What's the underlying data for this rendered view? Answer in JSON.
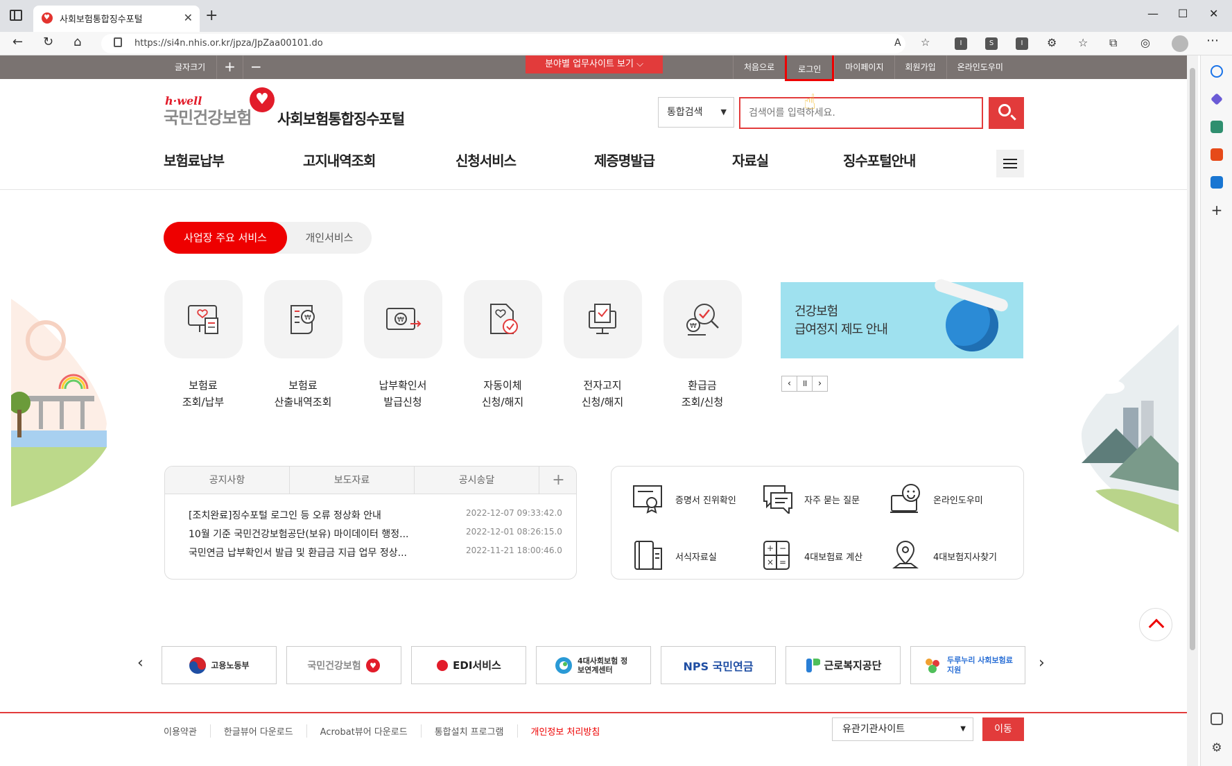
{
  "browser": {
    "tab_title": "사회보험통합징수포털",
    "url": "https://si4n.nhis.or.kr/jpza/JpZaa00101.do"
  },
  "util_bar": {
    "font_size_label": "글자크기",
    "font_plus": "+",
    "font_minus": "−",
    "field_site_button": "분야별 업무사이트 보기",
    "links": [
      "처음으로",
      "로그인",
      "마이페이지",
      "회원가입",
      "온라인도우미"
    ]
  },
  "header": {
    "logo_small": "h·well",
    "logo_name": "국민건강보험",
    "site_title": "사회보험통합징수포털",
    "search_scope": "통합검색",
    "search_placeholder": "검색어를 입력하세요."
  },
  "gnb": [
    "보험료납부",
    "고지내역조회",
    "신청서비스",
    "제증명발급",
    "자료실",
    "징수포털안내"
  ],
  "service_tabs": {
    "active": "사업장 주요 서비스",
    "inactive": "개인서비스"
  },
  "services": [
    {
      "line1": "보험료",
      "line2": "조회/납부",
      "icon": "receipt-icon"
    },
    {
      "line1": "보험료",
      "line2": "산출내역조회",
      "icon": "calculation-doc-icon"
    },
    {
      "line1": "납부확인서",
      "line2": "발급신청",
      "icon": "payment-certificate-icon"
    },
    {
      "line1": "자동이체",
      "line2": "신청/해지",
      "icon": "auto-transfer-icon"
    },
    {
      "line1": "전자고지",
      "line2": "신청/해지",
      "icon": "e-notice-icon"
    },
    {
      "line1": "환급금",
      "line2": "조회/신청",
      "icon": "refund-search-icon"
    }
  ],
  "banner": {
    "line1": "건강보험",
    "line2": "급여정지 제도 안내"
  },
  "banner_controls": {
    "prev": "‹",
    "pause": "॥",
    "next": "›"
  },
  "notice": {
    "tabs": [
      "공지사항",
      "보도자료",
      "공시송달"
    ],
    "more": "+",
    "items": [
      {
        "title": "[조치완료]징수포털 로그인 등 오류 정상화 안내",
        "date": "2022-12-07 09:33:42.0"
      },
      {
        "title": "10월 기준 국민건강보험공단(보유) 마이데이터 행정...",
        "date": "2022-12-01 08:26:15.0"
      },
      {
        "title": "국민연금 납부확인서 발급 및 환급금 지급 업무 정상...",
        "date": "2022-11-21 18:00:46.0"
      }
    ]
  },
  "quick_links": [
    {
      "label": "증명서 진위확인",
      "icon": "certificate-verify-icon"
    },
    {
      "label": "자주 묻는 질문",
      "icon": "faq-icon"
    },
    {
      "label": "온라인도우미",
      "icon": "online-helper-icon"
    },
    {
      "label": "서식자료실",
      "icon": "forms-library-icon"
    },
    {
      "label": "4대보험료 계산",
      "icon": "calculator-icon"
    },
    {
      "label": "4대보험지사찾기",
      "icon": "location-pin-icon"
    }
  ],
  "orgs": [
    {
      "name": "고용노동부"
    },
    {
      "name": "국민건강보험"
    },
    {
      "name": "EDI서비스"
    },
    {
      "name": "4대사회보험 정보연계센터"
    },
    {
      "name": "NPS 국민연금"
    },
    {
      "name": "근로복지공단"
    },
    {
      "name": "두루누리 사회보험료 지원"
    }
  ],
  "org_nav": {
    "prev": "‹",
    "next": "›"
  },
  "footer": {
    "links": [
      "이용약관",
      "한글뷰어 다운로드",
      "Acrobat뷰어 다운로드",
      "통합설치 프로그램",
      "개인정보 처리방침"
    ],
    "related_sites": "유관기관사이트",
    "go_button": "이동"
  },
  "colors": {
    "accent": "#e23b3b",
    "util_bar": "#7a7371"
  }
}
